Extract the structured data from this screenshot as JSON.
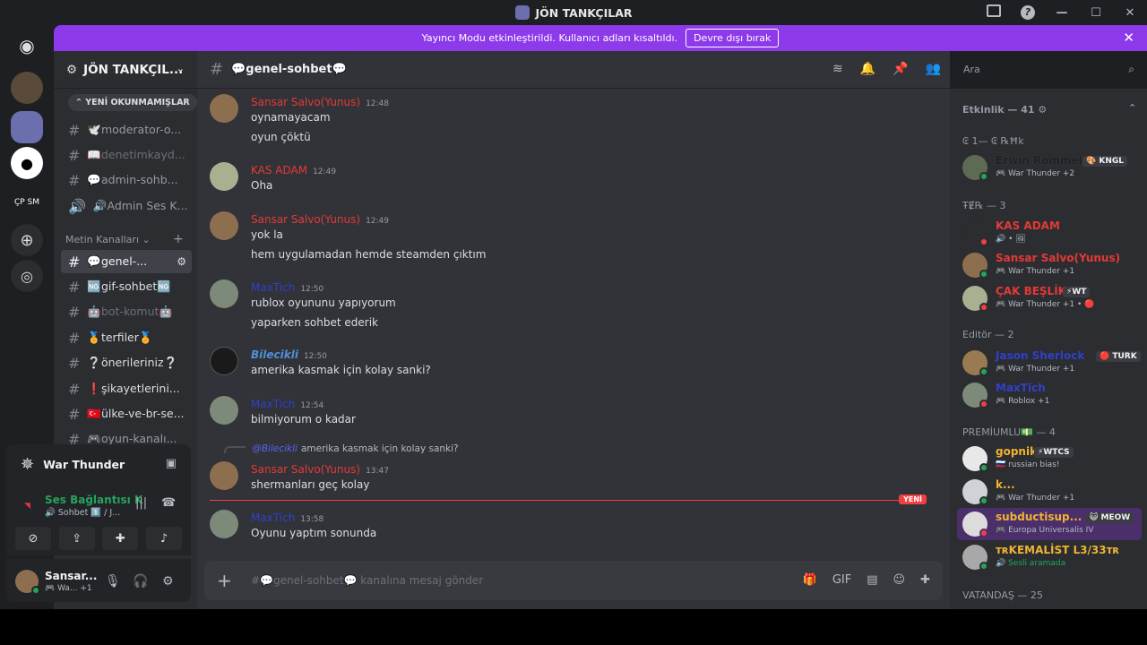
{
  "titlebar": {
    "title": "JÖN TANKÇILAR"
  },
  "banner": {
    "text": "Yayıncı Modu etkinleştirildi. Kullanıcı adları kısaltıldı.",
    "button": "Devre dışı bırak"
  },
  "server": {
    "name": "JÖN TANKÇIL..."
  },
  "sidebar": {
    "new_unreads": "YENİ OKUNMAMIŞLAR",
    "top_channels": [
      {
        "label": "🕊️moderator-o..."
      },
      {
        "label": "📖denetimkayd..."
      },
      {
        "label": "💬admin-sohb..."
      },
      {
        "label": "🔊Admin Ses K..."
      }
    ],
    "category": "Metin Kanalları",
    "channels": [
      {
        "label": "💬genel-...",
        "active": true
      },
      {
        "label": "🆖gif-sohbet🆖"
      },
      {
        "label": "🤖bot-komut🤖"
      },
      {
        "label": "🏅terfiler🏅"
      },
      {
        "label": "❔önerileriniz❔"
      },
      {
        "label": "❗şikayetlerini..."
      },
      {
        "label": "🇹🇷ülke-ve-br-se..."
      },
      {
        "label": "🎮oyun-kanalı..."
      }
    ]
  },
  "activity": {
    "game": "War Thunder"
  },
  "voice": {
    "status": "Ses Bağlantısı K",
    "channel": "🔊 Sohbet 1️⃣ / J..."
  },
  "user": {
    "name": "Sansar...",
    "status": "🎮 Wa...",
    "extra": "+1"
  },
  "header": {
    "channel": "💬genel-sohbet💬"
  },
  "search": {
    "placeholder": "Ara"
  },
  "messages": [
    {
      "author": "Sansar Salvo(Yunus)",
      "color": "#e53935",
      "time": "12:48",
      "lines": [
        "oynamayacam",
        "oyun çöktü"
      ]
    },
    {
      "author": "KAS ADAM",
      "color": "#e53935",
      "time": "12:49",
      "lines": [
        "Oha"
      ]
    },
    {
      "author": "Sansar Salvo(Yunus)",
      "color": "#e53935",
      "time": "12:49",
      "lines": [
        "yok la",
        "hem uygulamadan hemde steamden çıktım"
      ]
    },
    {
      "author": "MaxTich",
      "color": "#3040c8",
      "time": "12:50",
      "lines": [
        "rublox oyununu yapıyorum",
        "yaparken sohbet ederik"
      ]
    },
    {
      "author": "Bilecikli",
      "color": "#4f8fd8",
      "time": "12:50",
      "lines": [
        "amerika kasmak için kolay sanki?"
      ]
    },
    {
      "author": "MaxTich",
      "color": "#3040c8",
      "time": "12:54",
      "lines": [
        "bilmiyorum o kadar"
      ]
    },
    {
      "author": "Sansar Salvo(Yunus)",
      "color": "#e53935",
      "time": "13:47",
      "lines": [
        "shermanları geç kolay"
      ]
    },
    {
      "author": "MaxTich",
      "color": "#3040c8",
      "time": "13:58",
      "lines": [
        "Oyunu yaptım sonunda"
      ]
    }
  ],
  "reply": {
    "author": "@Bilecikli",
    "text": "amerika kasmak için kolay sanki?"
  },
  "new_divider": "YENİ",
  "composer": {
    "placeholder": "#💬genel-sohbet💬 kanalına mesaj gönder"
  },
  "members": {
    "activity_header": "Etkinlik — 41 ⚙",
    "groups": [
      {
        "header": "₢ 1— ₢ ℞Ħk",
        "items": [
          {
            "name": "Erwin Rommel",
            "color": "#1e1f22",
            "sub": "🎮 War Thunder +2",
            "tag": "🎨 KNGL",
            "status": "#23a55a"
          }
        ]
      },
      {
        "header": "ŦɆ℞ — 3",
        "items": [
          {
            "name": "KAS ADAM",
            "color": "#e53935",
            "sub": "🔊 • 🖼",
            "status": "#f23f43"
          },
          {
            "name": "Sansar Salvo(Yunus)",
            "color": "#e53935",
            "sub": "🎮 War Thunder +1",
            "status": "#23a55a"
          },
          {
            "name": "ÇAK BEŞLİK",
            "color": "#e53935",
            "sub": "🎮 War Thunder +1 • 🔴",
            "tag": "⚡WT",
            "status": "#f23f43"
          }
        ]
      },
      {
        "header": "Editör — 2",
        "items": [
          {
            "name": "Jason Sherlock",
            "color": "#3040c8",
            "sub": "🎮 War Thunder +1",
            "tag": "🔴 TURK",
            "status": "#23a55a"
          },
          {
            "name": "MaxTich",
            "color": "#3040c8",
            "sub": "🎮 Roblox +1",
            "status": "#f23f43"
          }
        ]
      },
      {
        "header": "PREMİUMLU💵 — 4",
        "items": [
          {
            "name": "gopnik",
            "color": "#f0b232",
            "sub": "🇷🇺 russian bias!",
            "tag": "⚡WTCS",
            "status": "#23a55a"
          },
          {
            "name": "k...",
            "color": "#f0b232",
            "sub": "🎮 War Thunder +1",
            "status": "#23a55a"
          },
          {
            "name": "subductisup...",
            "color": "#f0b232",
            "sub": "🎮 Europa Universalis IV",
            "tag": "😺 MEOW",
            "status": "#f23f43"
          },
          {
            "name": "ᴛʀKEMALİST L3/33ᴛʀ",
            "color": "#f0b232",
            "sub": "🔊 Sesli aramada",
            "status": "#23a55a"
          }
        ]
      }
    ],
    "last_header": "VATANDAŞ — 25"
  }
}
